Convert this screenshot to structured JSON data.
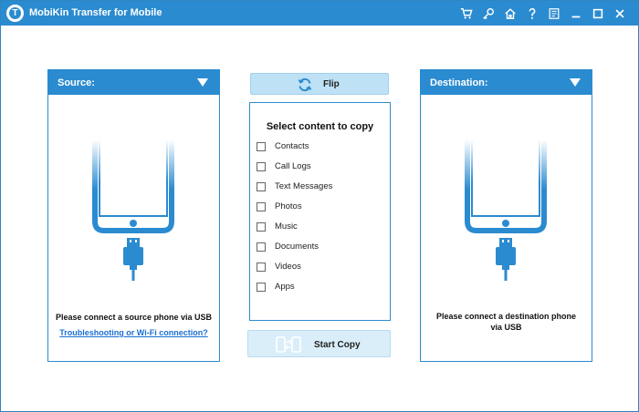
{
  "titlebar": {
    "logo_letter": "T",
    "title": "MobiKin Transfer for Mobile",
    "icons": [
      "cart-icon",
      "key-icon",
      "home-icon",
      "help-icon",
      "feedback-icon",
      "minimize-icon",
      "maximize-icon",
      "close-icon"
    ]
  },
  "source": {
    "header": "Source:",
    "message": "Please connect a source phone via USB",
    "link": "Troubleshooting or Wi-Fi connection?"
  },
  "flip": {
    "label": "Flip"
  },
  "content": {
    "title": "Select content to copy",
    "items": [
      {
        "label": "Contacts",
        "checked": false
      },
      {
        "label": "Call Logs",
        "checked": false
      },
      {
        "label": "Text Messages",
        "checked": false
      },
      {
        "label": "Photos",
        "checked": false
      },
      {
        "label": "Music",
        "checked": false
      },
      {
        "label": "Documents",
        "checked": false
      },
      {
        "label": "Videos",
        "checked": false
      },
      {
        "label": "Apps",
        "checked": false
      }
    ]
  },
  "start_copy": {
    "label": "Start Copy"
  },
  "destination": {
    "header": "Destination:",
    "message_line1": "Please connect a destination phone",
    "message_line2": "via USB"
  },
  "colors": {
    "accent": "#2b8bd0",
    "flip_bg": "#bfe1f5",
    "start_bg": "#d9eef9",
    "link": "#1a6fd1"
  }
}
